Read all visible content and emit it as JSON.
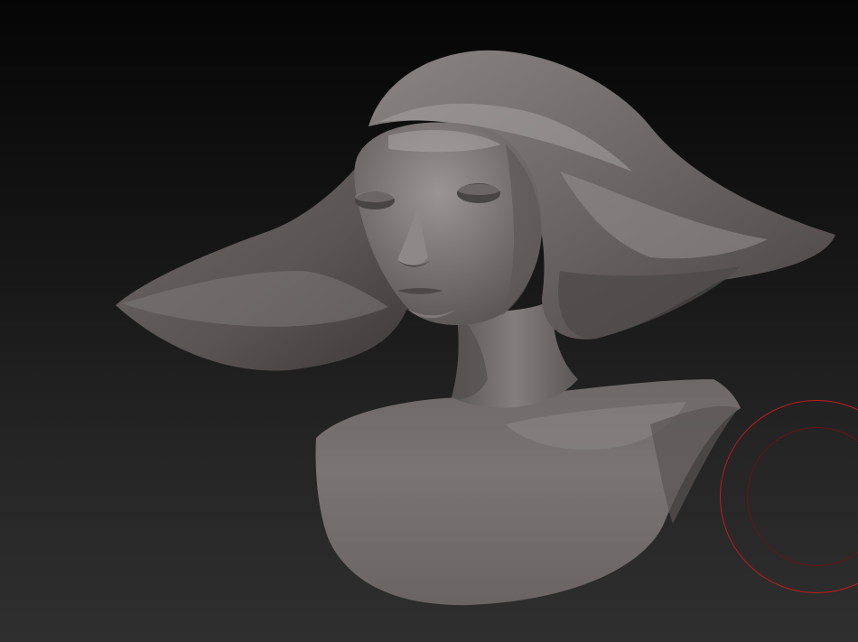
{
  "app": {
    "name": "",
    "mode": "sculpt"
  },
  "canvas": {
    "subject": "bust-sculpt",
    "material": "matcap-gray",
    "background_top": "#050505",
    "background_bottom": "#2f2f2f",
    "model_color": "#7a7474"
  },
  "brush": {
    "icon": "brush-radius-icon",
    "outer_color": "#c51a1a",
    "inner_color": "#6a1414"
  }
}
